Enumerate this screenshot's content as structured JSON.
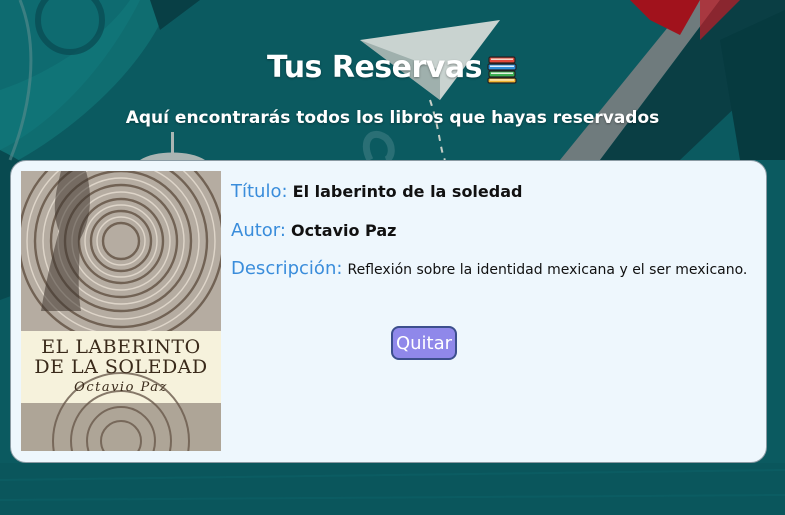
{
  "header": {
    "title": "Tus Reservas",
    "title_icon": "books-icon",
    "subtitle": "Aquí encontrarás todos los libros que hayas reservados"
  },
  "reservation": {
    "cover": {
      "title_line1": "EL LABERINTO",
      "title_line2": "DE LA SOLEDAD",
      "author": "Octavio Paz"
    },
    "title_label": "Título:",
    "title_value": "El laberinto de la soledad",
    "author_label": "Autor:",
    "author_value": "Octavio Paz",
    "description_label": "Descripción:",
    "description_value": "Reflexión sobre la identidad mexicana y el ser mexicano.",
    "remove_label": "Quitar"
  },
  "colors": {
    "background": "#0b5a60",
    "card_background": "#eef7fd",
    "label_blue": "#3a8ddb",
    "button_purple": "#8f88ea",
    "button_border": "#3c4f8d"
  }
}
